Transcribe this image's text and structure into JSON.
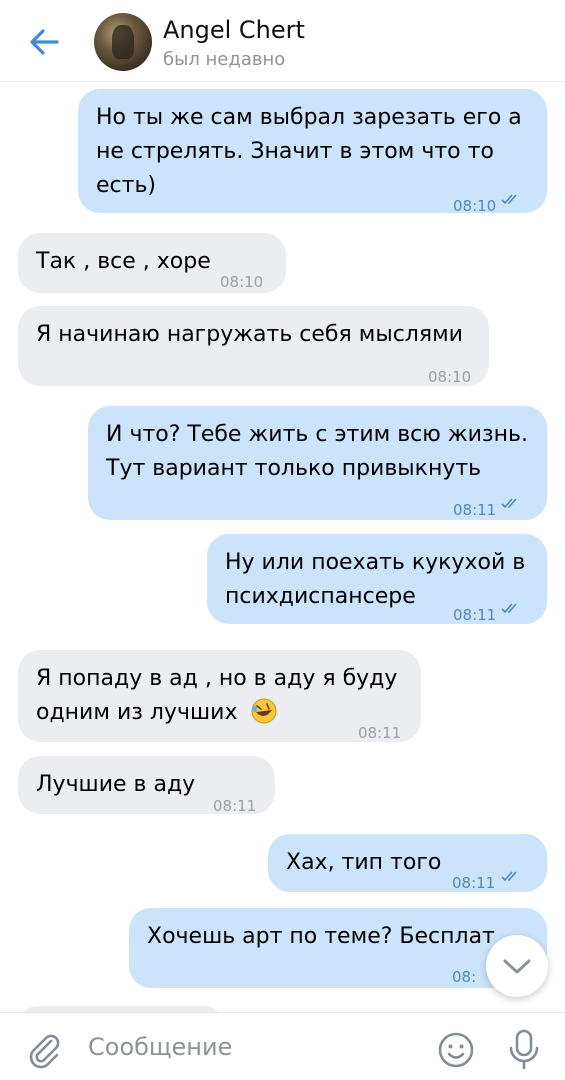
{
  "header": {
    "contact_name": "Angel Chert",
    "status": "был недавно"
  },
  "messages": [
    {
      "dir": "out",
      "lines": [
        "Но ты же сам выбрал зарезать его а",
        "не стрелять. Значит в этом что то",
        "есть)"
      ],
      "time": "08:10",
      "read": true
    },
    {
      "dir": "in",
      "lines": [
        "Так , все , хоре"
      ],
      "time": "08:10"
    },
    {
      "dir": "in",
      "lines": [
        "Я начинаю нагружать себя мыслями"
      ],
      "time": "08:10"
    },
    {
      "dir": "out",
      "lines": [
        "И что? Тебе жить с этим всю жизнь.",
        "Тут вариант только привыкнуть"
      ],
      "time": "08:11",
      "read": true
    },
    {
      "dir": "out",
      "lines": [
        "Ну или поехать кукухой в",
        "психдиспансере"
      ],
      "time": "08:11",
      "read": true
    },
    {
      "dir": "in",
      "lines": [
        "Я попаду в ад , но в аду я буду",
        "одним из лучших"
      ],
      "emoji": "rolling-on-floor-laughing",
      "time": "08:11"
    },
    {
      "dir": "in",
      "lines": [
        "Лучшие в аду"
      ],
      "time": "08:11"
    },
    {
      "dir": "out",
      "lines": [
        "Хах, тип того"
      ],
      "time": "08:11",
      "read": true
    },
    {
      "dir": "out",
      "lines": [
        "Хочешь арт по теме? Бесплат"
      ],
      "time": "08:"
    }
  ],
  "composer": {
    "placeholder": "Сообщение"
  },
  "colors": {
    "accent": "#3f8ae0",
    "outgoing_bubble": "#cce4fb",
    "incoming_bubble": "#ebedf0"
  }
}
